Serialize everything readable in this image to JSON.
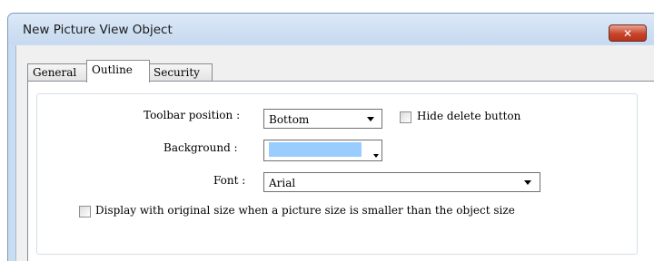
{
  "window": {
    "title": "New Picture View Object",
    "close_glyph": "✕"
  },
  "tabs": [
    {
      "label": "General",
      "active": false
    },
    {
      "label": "Outline",
      "active": true
    },
    {
      "label": "Security",
      "active": false
    }
  ],
  "outline": {
    "toolbar_position": {
      "label": "Toolbar position :",
      "value": "Bottom"
    },
    "hide_delete_button": {
      "label": "Hide delete button",
      "checked": false
    },
    "background": {
      "label": "Background :",
      "color": "#99ccff"
    },
    "font": {
      "label": "Font :",
      "value": "Arial"
    },
    "original_size": {
      "label": "Display with original size when a picture size is smaller than the object size",
      "checked": false
    }
  },
  "colors": {
    "title_bar": "#c9dcf1",
    "close_button": "#c7452a",
    "background_swatch": "#99ccff"
  }
}
